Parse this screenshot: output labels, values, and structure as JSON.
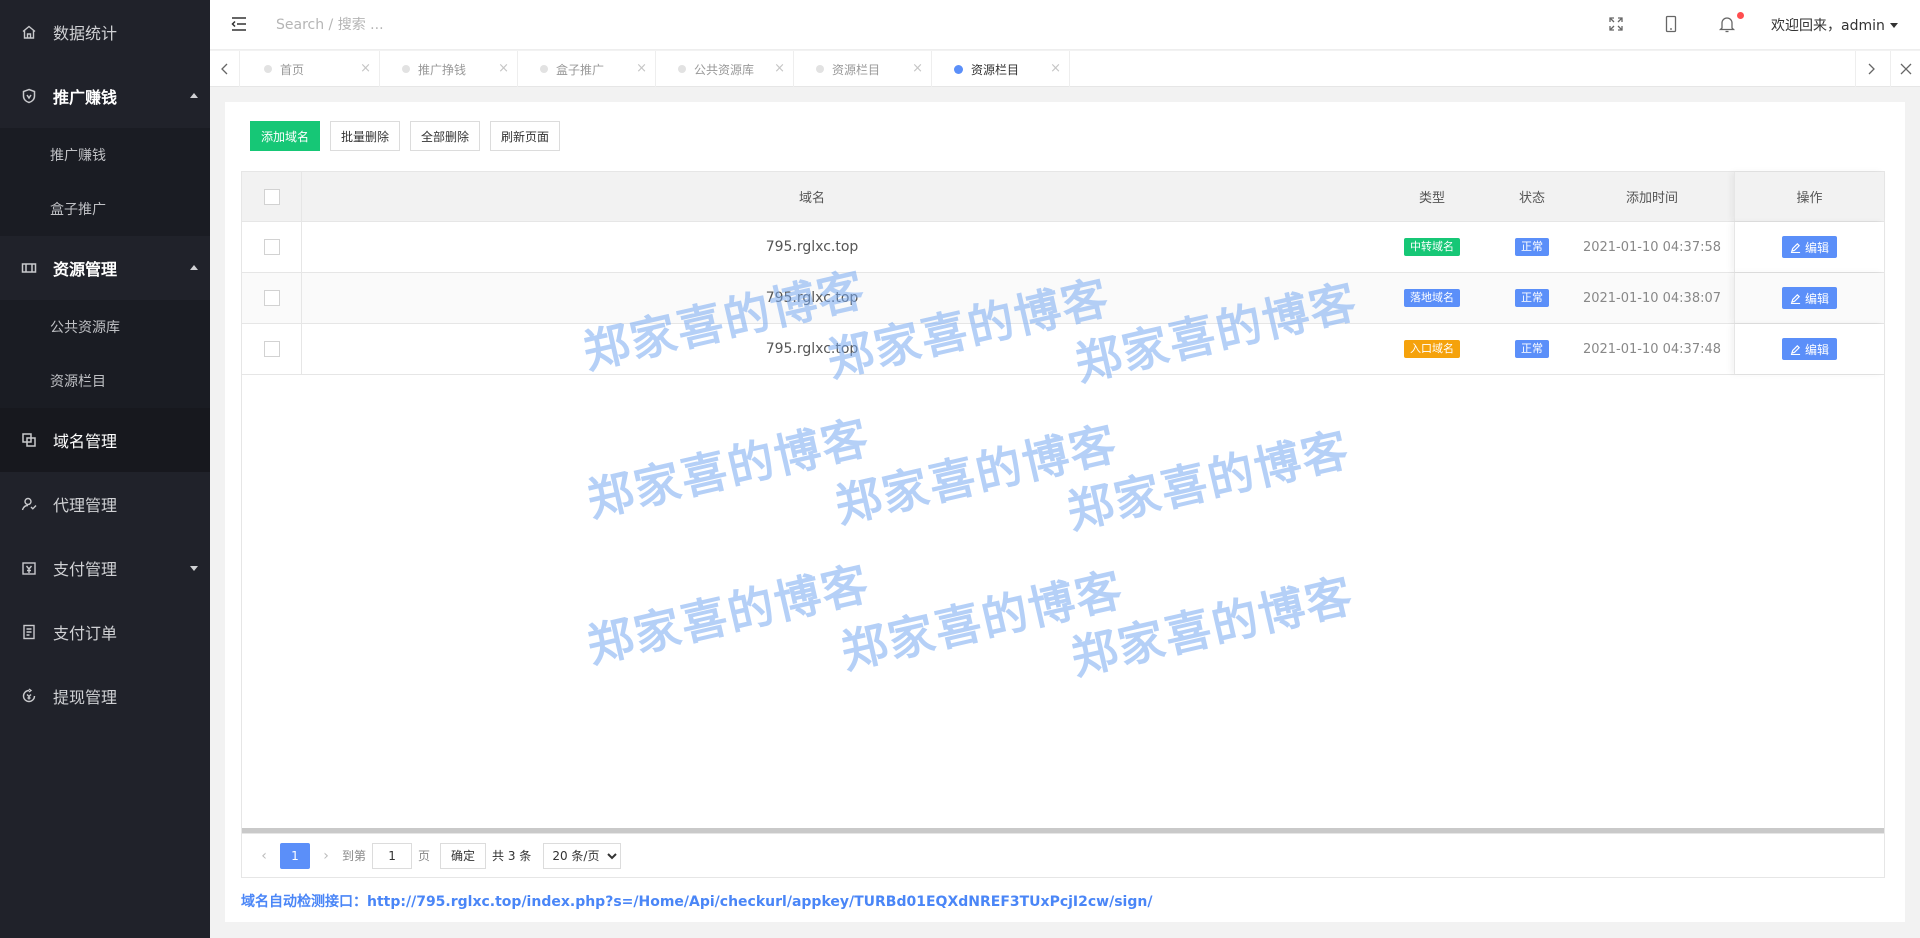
{
  "sidebar": {
    "items": [
      {
        "label": "数据统计",
        "icon": "home-icon"
      },
      {
        "label": "推广赚钱",
        "icon": "shield-icon",
        "expanded": true,
        "children": [
          "推广赚钱",
          "盒子推广"
        ]
      },
      {
        "label": "资源管理",
        "icon": "resource-icon",
        "expanded": true,
        "children": [
          "公共资源库",
          "资源栏目"
        ]
      },
      {
        "label": "域名管理",
        "icon": "copy-icon",
        "active": true
      },
      {
        "label": "代理管理",
        "icon": "agent-icon"
      },
      {
        "label": "支付管理",
        "icon": "payment-icon",
        "expandable": true
      },
      {
        "label": "支付订单",
        "icon": "order-icon"
      },
      {
        "label": "提现管理",
        "icon": "withdraw-icon"
      }
    ]
  },
  "header": {
    "search_placeholder": "Search / 搜索 ...",
    "user": "欢迎回来，admin"
  },
  "tabs": [
    {
      "label": "首页",
      "active": false
    },
    {
      "label": "推广挣钱",
      "active": false
    },
    {
      "label": "盒子推广",
      "active": false
    },
    {
      "label": "公共资源库",
      "active": false
    },
    {
      "label": "资源栏目",
      "active": false
    },
    {
      "label": "资源栏目",
      "active": true
    }
  ],
  "toolbar": {
    "add": "添加域名",
    "batch_delete": "批量删除",
    "delete_all": "全部删除",
    "refresh": "刷新页面"
  },
  "table": {
    "columns": {
      "domain": "域名",
      "type": "类型",
      "status": "状态",
      "time": "添加时间",
      "action": "操作"
    },
    "rows": [
      {
        "domain": "795.rglxc.top",
        "type": "中转域名",
        "type_color": "#16c776",
        "status": "正常",
        "time": "2021-01-10 04:37:58"
      },
      {
        "domain": "795.rglxc.top",
        "type": "落地域名",
        "type_color": "#5b8ff9",
        "status": "正常",
        "time": "2021-01-10 04:38:07"
      },
      {
        "domain": "795.rglxc.top",
        "type": "入口域名",
        "type_color": "#f5a20c",
        "status": "正常",
        "time": "2021-01-10 04:37:48"
      }
    ],
    "edit_label": "编辑",
    "status_color": "#5b8ff9"
  },
  "pager": {
    "current": "1",
    "goto_label": "到第",
    "page_input": "1",
    "page_unit": "页",
    "ok": "确定",
    "total": "共 3 条",
    "page_size": "20 条/页"
  },
  "footer_note": "域名自动检测接口：http://795.rglxc.top/index.php?s=/Home/Api/checkurl/appkey/TURBd01EQXdNREF3TUxPcjI2cw/sign/",
  "watermark": "郑家喜的博客",
  "colors": {
    "sidebar_bg": "#20222a",
    "accent": "#5b8ff9",
    "primary_green": "#16c776"
  }
}
